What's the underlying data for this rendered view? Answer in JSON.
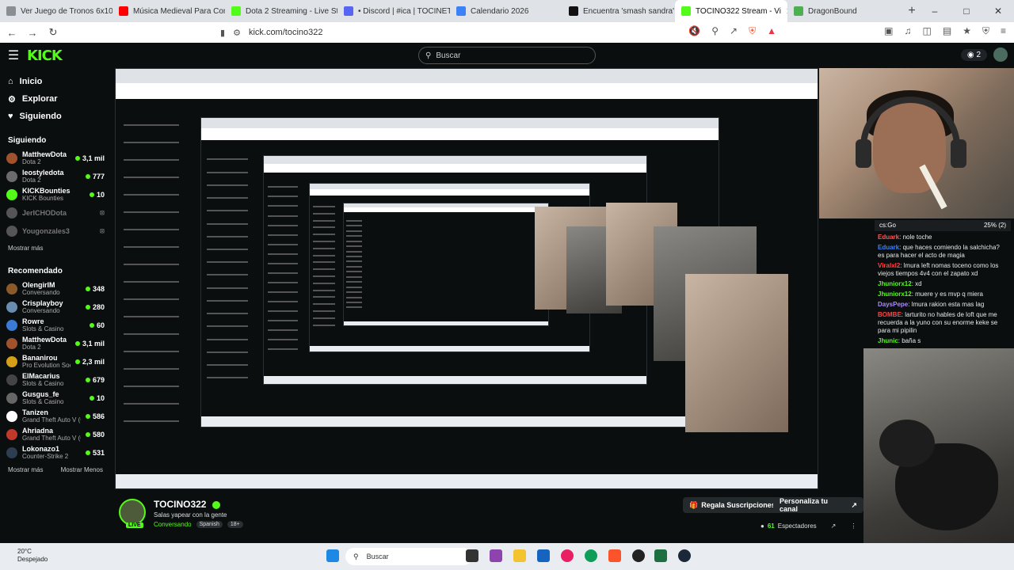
{
  "browser": {
    "tabs": [
      {
        "title": "Ver Juego de Tronos 6x10 Onli",
        "color": "#8a8f94"
      },
      {
        "title": "Música Medieval Para Concen",
        "color": "#ff0000"
      },
      {
        "title": "Dota 2 Streaming - Live Stream",
        "color": "#53fc18"
      },
      {
        "title": "• Discord | #ica | TOCINETA fa",
        "color": "#5865f2"
      },
      {
        "title": "Calendario 2026",
        "color": "#3b82f6"
      },
      {
        "title": "Encuentra 'smash sandra' en T",
        "color": "#111111"
      },
      {
        "title": "TOCINO322 Stream - Vi",
        "color": "#53fc18"
      },
      {
        "title": "DragonBound",
        "color": "#4caf50"
      }
    ],
    "url": "kick.com/tocino322"
  },
  "header": {
    "logo": "KICK",
    "search_placeholder": "Buscar",
    "coins": "2"
  },
  "sidebar": {
    "nav": [
      {
        "label": "Inicio",
        "icon": "home-icon"
      },
      {
        "label": "Explorar",
        "icon": "compass-icon"
      },
      {
        "label": "Siguiendo",
        "icon": "heart-icon"
      }
    ],
    "following_title": "Siguiendo",
    "following": [
      {
        "name": "MatthewDota",
        "category": "Dota 2",
        "viewers": "3,1 mil",
        "color": "#a0522d",
        "online": true
      },
      {
        "name": "leostyledota",
        "category": "Dota 2",
        "viewers": "777",
        "color": "#6b6b6b",
        "online": true
      },
      {
        "name": "KICKBounties",
        "category": "KICK Bounties",
        "viewers": "10",
        "color": "#53fc18",
        "online": true
      },
      {
        "name": "JerICHODota",
        "category": "",
        "viewers": "",
        "color": "#555555",
        "online": false
      },
      {
        "name": "Yougonzales3",
        "category": "",
        "viewers": "",
        "color": "#555555",
        "online": false
      }
    ],
    "show_more": "Mostrar más",
    "recommended_title": "Recomendado",
    "recommended": [
      {
        "name": "OlengirIM",
        "category": "Conversando",
        "viewers": "348",
        "color": "#8b5a2b"
      },
      {
        "name": "Crisplayboy",
        "category": "Conversando",
        "viewers": "280",
        "color": "#6a8caf"
      },
      {
        "name": "Rowre",
        "category": "Slots & Casino",
        "viewers": "60",
        "color": "#3a7bd5"
      },
      {
        "name": "MatthewDota",
        "category": "Dota 2",
        "viewers": "3,1 mil",
        "color": "#a0522d"
      },
      {
        "name": "Bananirou",
        "category": "Pro Evolution Soccer",
        "viewers": "2,3 mil",
        "color": "#d4a017"
      },
      {
        "name": "ElMacarius",
        "category": "Slots & Casino",
        "viewers": "679",
        "color": "#444444"
      },
      {
        "name": "Gusgus_fe",
        "category": "Slots & Casino",
        "viewers": "10",
        "color": "#666666"
      },
      {
        "name": "Tanizen",
        "category": "Grand Theft Auto V (G...",
        "viewers": "586",
        "color": "#ffffff"
      },
      {
        "name": "Ahriadna",
        "category": "Grand Theft Auto V (G...",
        "viewers": "580",
        "color": "#c0392b"
      },
      {
        "name": "Lokonazo1",
        "category": "Counter-Strike 2",
        "viewers": "531",
        "color": "#2c3e50"
      }
    ],
    "show_more2": "Mostrar más",
    "show_less": "Mostrar Menos"
  },
  "chat": {
    "poll_label": "cs:Go",
    "poll_value": "25% (2)",
    "messages": [
      {
        "user": "Eduark",
        "color": "#ff5555",
        "text": "nole toche"
      },
      {
        "user": "Eduark",
        "color": "#3b82f6",
        "text": "que haces comiendo la salchicha? es para hacer el acto de magia"
      },
      {
        "user": "Viralxl2",
        "color": "#ff4444",
        "text": "lmura left nomas toceno como los viejos tiempos 4v4 con el zapato xd"
      },
      {
        "user": "Jhuniorx12",
        "color": "#53fc18",
        "text": "xd"
      },
      {
        "user": "Jhuniorx12",
        "color": "#53fc18",
        "text": "muere y es mvp q miera"
      },
      {
        "user": "DaysPepe",
        "color": "#a78bfa",
        "text": "lmura rakion esta mas lag"
      },
      {
        "user": "BOMBE",
        "color": "#ff4444",
        "text": "larturito no hables de loft que me recuerda a la yuno con su enorme keke se para mi pipilin"
      },
      {
        "user": "Jhunic",
        "color": "#53fc18",
        "text": "baña s"
      }
    ]
  },
  "stream": {
    "name": "TOCINO322",
    "title": "Salas yapear con la gente",
    "category": "Conversando",
    "language": "Spanish",
    "age": "18+",
    "live": "LIVE",
    "gift_button": "Regala Suscripciones",
    "customize_button": "Personaliza tu canal",
    "viewers": "61",
    "viewers_label": "Espectadores"
  },
  "taskbar": {
    "temp": "20°C",
    "weather": "Despejado",
    "search": "Buscar"
  }
}
